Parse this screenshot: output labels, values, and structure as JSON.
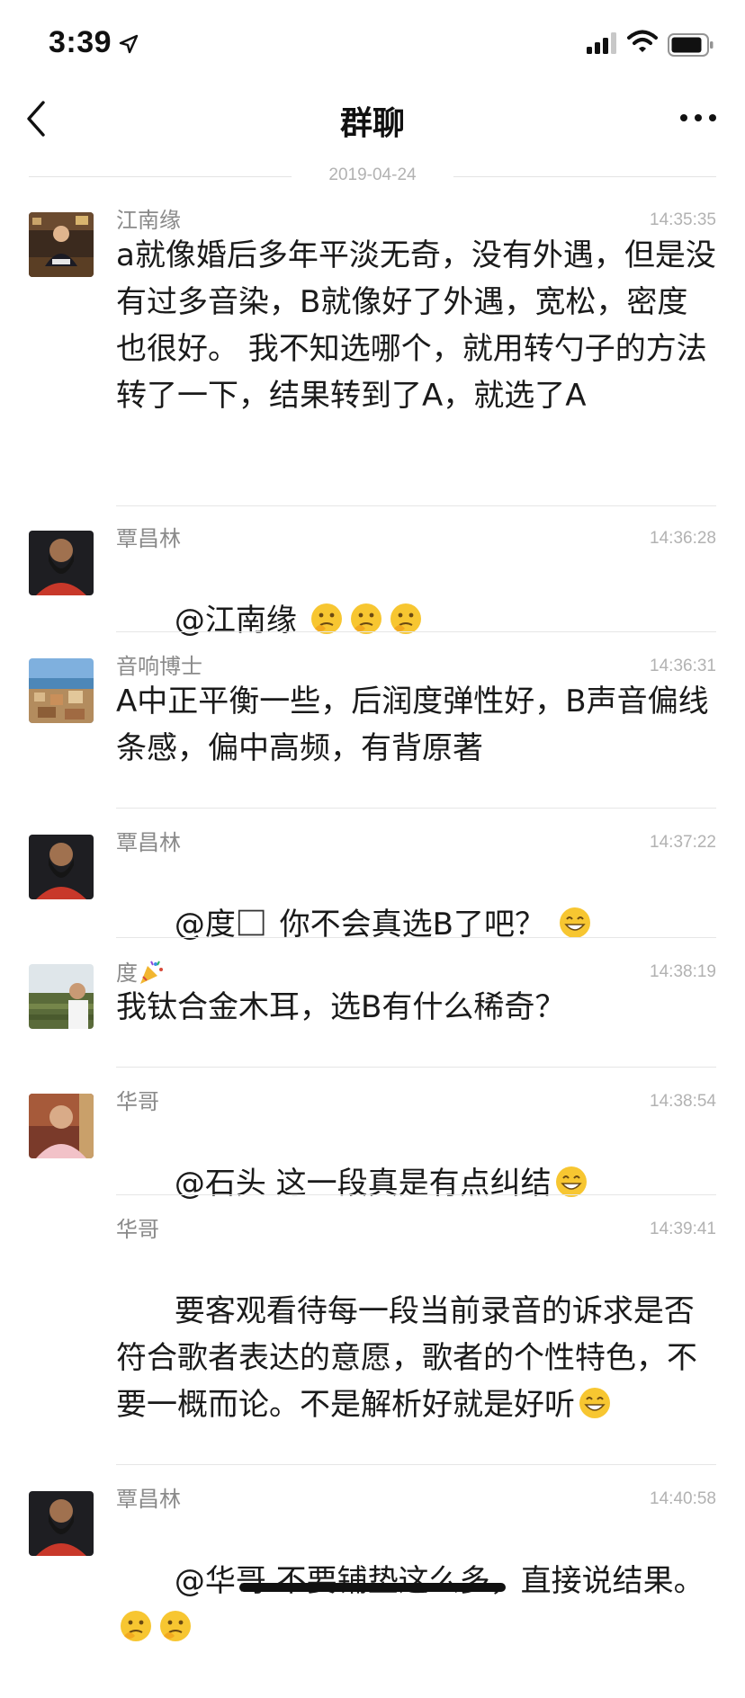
{
  "status_bar": {
    "time": "3:39",
    "location_icon": "location-arrow-icon",
    "signal_icon": "cellular-signal-icon",
    "wifi_icon": "wifi-icon",
    "battery_icon": "battery-icon"
  },
  "nav": {
    "title": "群聊",
    "back_icon": "chevron-left-icon",
    "more_icon": "ellipsis-icon"
  },
  "date_divider": "2019-04-24",
  "messages": [
    {
      "sender": "江南缘",
      "time": "14:35:35",
      "text": "a就像婚后多年平淡无奇，没有外遇，但是没有过多音染，B就像好了外遇，宽松，密度也很好。 我不知选哪个，就用转勺子的方法转了一下，结果转到了A，就选了A",
      "avatar": "avatar-jiangnanyuan"
    },
    {
      "sender": "覃昌林",
      "time": "14:36:28",
      "text": "@江南缘 ",
      "emojis": [
        "thinking-face-icon",
        "thinking-face-icon",
        "thinking-face-icon"
      ],
      "avatar": "avatar-qinchanglin"
    },
    {
      "sender": "音响博士",
      "time": "14:36:31",
      "text": "A中正平衡一些，后润度弹性好，B声音偏线条感，偏中高频，有背原著",
      "avatar": "avatar-yinxiangboshi"
    },
    {
      "sender": "覃昌林",
      "time": "14:37:22",
      "text": "@度",
      "text_after": " 你不会真选B了吧？ ",
      "emojis": [
        "grinning-face-icon"
      ],
      "avatar": "avatar-qinchanglin"
    },
    {
      "sender": "度",
      "sender_emoji": "party-popper-icon",
      "time": "14:38:19",
      "text": "我钛合金木耳，选B有什么稀奇？",
      "avatar": "avatar-du"
    },
    {
      "sender": "华哥",
      "time": "14:38:54",
      "text": "@石头 这一段真是有点纠结",
      "emojis": [
        "grinning-face-icon"
      ],
      "avatar": "avatar-huage"
    },
    {
      "sender": "华哥",
      "time": "14:39:41",
      "text": "要客观看待每一段当前录音的诉求是否符合歌者表达的意愿，歌者的个性特色，不要一概而论。不是解析好就是好听",
      "emojis": [
        "grinning-face-icon"
      ]
    },
    {
      "sender": "覃昌林",
      "time": "14:40:58",
      "text": "@华哥 不要铺垫这么多，直接说结果。",
      "emojis": [
        "thinking-face-icon",
        "thinking-face-icon"
      ],
      "avatar": "avatar-qinchanglin"
    }
  ]
}
